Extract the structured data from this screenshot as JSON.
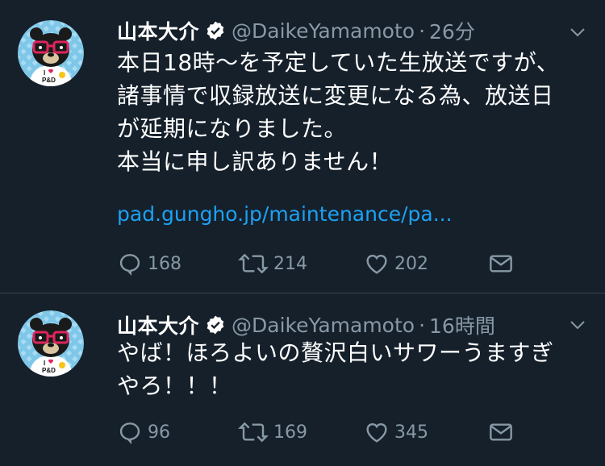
{
  "tweets": [
    {
      "display_name": "山本大介",
      "handle": "@DaikeYamamoto",
      "separator": "·",
      "time": "26分",
      "body_lines": [
        "本日18時〜を予定していた生放送ですが、",
        "諸事情で収録放送に変更になる為、放送日",
        "が延期になりました。",
        "本当に申し訳ありません！"
      ],
      "link": "pad.gungho.jp/maintenance/pa...",
      "replies": "168",
      "retweets": "214",
      "likes": "202"
    },
    {
      "display_name": "山本大介",
      "handle": "@DaikeYamamoto",
      "separator": "·",
      "time": "16時間",
      "body_lines": [
        "やば！ほろよいの贅沢白いサワーうますぎ",
        "やろ！！！"
      ],
      "replies": "96",
      "retweets": "169",
      "likes": "345"
    }
  ],
  "avatar_text": {
    "line1": "I",
    "line2": "P&D"
  },
  "colors": {
    "background": "#15202b",
    "secondary_text": "#8899a6",
    "link": "#1da1f2",
    "divider": "#38444d"
  }
}
